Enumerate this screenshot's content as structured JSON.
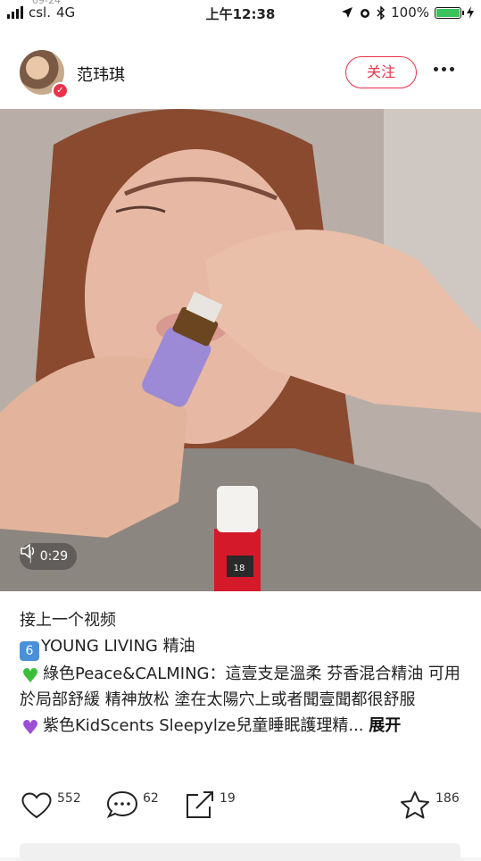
{
  "status_bar": {
    "carrier": "csl.",
    "network": "4G",
    "time": "上午12:38",
    "battery_percent": "100%",
    "date_overlay": "09-24"
  },
  "post": {
    "username": "范玮琪",
    "follow_label": "关注",
    "video_time": "0:29",
    "bottle_label": "18"
  },
  "caption": {
    "line1": "接上一个视频",
    "num_emoji": "6",
    "line2": "YOUNG LIVING 精油",
    "line3": "綠色Peace&CALMING：這壹支是溫柔 芬香混合精油 可用於局部舒緩 精神放松 塗在太陽穴上或者聞壹聞都很舒服",
    "line4": "紫色KidScents Sleepylze兒童睡眠護理精...",
    "expand": "展开"
  },
  "actions": {
    "likes": "552",
    "comments": "62",
    "shares": "19",
    "favorites": "186"
  },
  "colors": {
    "accent": "#e8334a",
    "battery": "#39c35a"
  }
}
